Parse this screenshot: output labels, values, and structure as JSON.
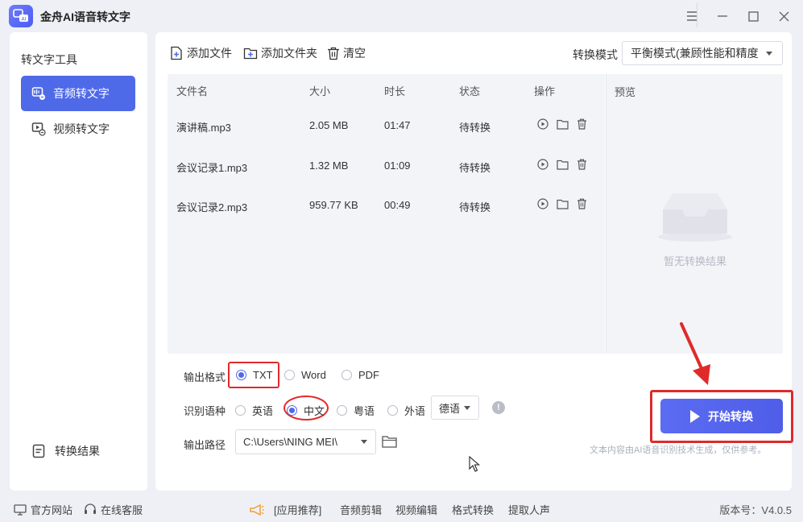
{
  "app": {
    "title": "金舟AI语音转文字"
  },
  "sidebar": {
    "title": "转文字工具",
    "items": [
      {
        "label": "音频转文字",
        "active": true
      },
      {
        "label": "视频转文字",
        "active": false
      }
    ],
    "result_label": "转换结果"
  },
  "toolbar": {
    "add_file": "添加文件",
    "add_folder": "添加文件夹",
    "clear": "清空",
    "mode_label": "转换模式",
    "mode_value": "平衡模式(兼顾性能和精度"
  },
  "table": {
    "headers": [
      "文件名",
      "大小",
      "时长",
      "状态",
      "操作"
    ],
    "rows": [
      {
        "name": "演讲稿.mp3",
        "size": "2.05 MB",
        "duration": "01:47",
        "status": "待转换"
      },
      {
        "name": "会议记录1.mp3",
        "size": "1.32 MB",
        "duration": "01:09",
        "status": "待转换"
      },
      {
        "name": "会议记录2.mp3",
        "size": "959.77 KB",
        "duration": "00:49",
        "status": "待转换"
      }
    ]
  },
  "preview": {
    "title": "预览",
    "empty_text": "暂无转换结果"
  },
  "output_format": {
    "label": "输出格式",
    "options": [
      {
        "label": "TXT",
        "selected": true
      },
      {
        "label": "Word",
        "selected": false
      },
      {
        "label": "PDF",
        "selected": false
      }
    ]
  },
  "language": {
    "label": "识别语种",
    "options": [
      {
        "label": "英语",
        "selected": false
      },
      {
        "label": "中文",
        "selected": true
      },
      {
        "label": "粤语",
        "selected": false
      },
      {
        "label": "外语",
        "selected": false
      }
    ],
    "foreign_value": "德语"
  },
  "output_path": {
    "label": "输出路径",
    "value": "C:\\Users\\NING MEI\\"
  },
  "start_button": "开始转换",
  "disclaimer": "文本内容由AI语音识别技术生成，仅供参考。",
  "footer": {
    "website": "官方网站",
    "support": "在线客服",
    "recommend": "[应用推荐]",
    "links": [
      "音频剪辑",
      "视频编辑",
      "格式转换",
      "提取人声"
    ],
    "version": "版本号：V4.0.5"
  },
  "colors": {
    "accent": "#4f6ae8",
    "highlight": "#e02a2a"
  }
}
